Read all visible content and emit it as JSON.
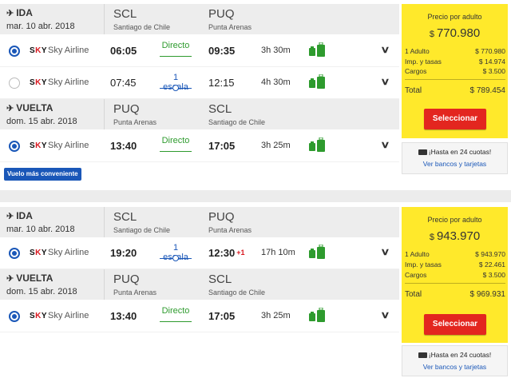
{
  "results": [
    {
      "segments": [
        {
          "direction": "IDA",
          "date": "mar. 10 abr. 2018",
          "origin_code": "SCL",
          "origin_city": "Santiago de Chile",
          "dest_code": "PUQ",
          "dest_city": "Punta Arenas",
          "options": [
            {
              "selected": true,
              "logo": "SKY",
              "airline": "Sky Airline",
              "dep": "06:05",
              "stops": "Directo",
              "arr": "09:35",
              "plus": "",
              "duration": "3h 30m"
            },
            {
              "selected": false,
              "logo": "SKY",
              "airline": "Sky Airline",
              "dep": "07:45",
              "stops": "1 escala",
              "arr": "12:15",
              "plus": "",
              "duration": "4h 30m"
            }
          ]
        },
        {
          "direction": "VUELTA",
          "date": "dom. 15 abr. 2018",
          "origin_code": "PUQ",
          "origin_city": "Punta Arenas",
          "dest_code": "SCL",
          "dest_city": "Santiago de Chile",
          "options": [
            {
              "selected": true,
              "logo": "SKY",
              "airline": "Sky Airline",
              "dep": "13:40",
              "stops": "Directo",
              "arr": "17:05",
              "plus": "",
              "duration": "3h 25m"
            }
          ]
        }
      ],
      "badge": "Vuelo más conveniente",
      "price": {
        "label": "Precio por adulto",
        "currency": "$",
        "amount": "770.980",
        "breakdown": [
          {
            "label": "1 Adulto",
            "value": "$ 770.980"
          },
          {
            "label": "Imp. y tasas",
            "value": "$ 14.974"
          },
          {
            "label": "Cargos",
            "value": "$ 3.500"
          }
        ],
        "total_label": "Total",
        "total_value": "$ 789.454",
        "button": "Seleccionar"
      },
      "installments": {
        "text": "¡Hasta en 24 cuotas!",
        "link": "Ver bancos y tarjetas"
      }
    },
    {
      "segments": [
        {
          "direction": "IDA",
          "date": "mar. 10 abr. 2018",
          "origin_code": "SCL",
          "origin_city": "Santiago de Chile",
          "dest_code": "PUQ",
          "dest_city": "Punta Arenas",
          "options": [
            {
              "selected": true,
              "logo": "SKY",
              "airline": "Sky Airline",
              "dep": "19:20",
              "stops": "1 escala",
              "arr": "12:30",
              "plus": "+1",
              "duration": "17h 10m"
            }
          ]
        },
        {
          "direction": "VUELTA",
          "date": "dom. 15 abr. 2018",
          "origin_code": "PUQ",
          "origin_city": "Punta Arenas",
          "dest_code": "SCL",
          "dest_city": "Santiago de Chile",
          "options": [
            {
              "selected": true,
              "logo": "SKY",
              "airline": "Sky Airline",
              "dep": "13:40",
              "stops": "Directo",
              "arr": "17:05",
              "plus": "",
              "duration": "3h 25m"
            }
          ]
        }
      ],
      "price": {
        "label": "Precio por adulto",
        "currency": "$",
        "amount": "943.970",
        "breakdown": [
          {
            "label": "1 Adulto",
            "value": "$ 943.970"
          },
          {
            "label": "Imp. y tasas",
            "value": "$ 22.461"
          },
          {
            "label": "Cargos",
            "value": "$ 3.500"
          }
        ],
        "total_label": "Total",
        "total_value": "$ 969.931",
        "button": "Seleccionar"
      },
      "installments": {
        "text": "¡Hasta en 24 cuotas!",
        "link": "Ver bancos y tarjetas"
      }
    }
  ],
  "colors": {
    "accent_blue": "#1a57b8",
    "direct_green": "#2e9b2e",
    "price_yellow": "#ffe92b",
    "select_red": "#e3261f"
  }
}
